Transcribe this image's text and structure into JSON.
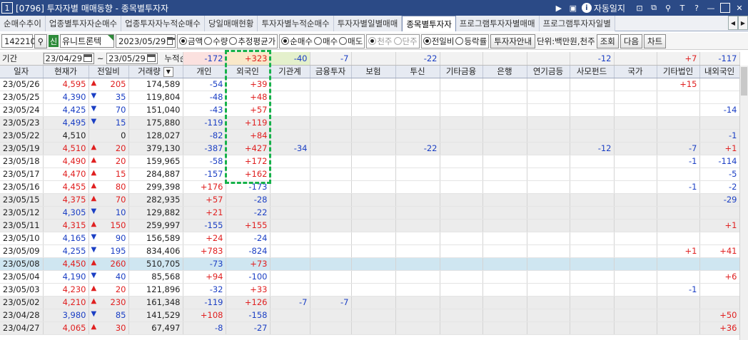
{
  "window": {
    "screen_no": "1",
    "title": "[0796] 투자자별 매매동향 - 종목별투자자",
    "autolock_label": "자동일지",
    "help_label": "?"
  },
  "tabs": [
    {
      "label": "순매수추이",
      "active": false
    },
    {
      "label": "업종별투자자순매수",
      "active": false
    },
    {
      "label": "업종투자자누적순매수",
      "active": false
    },
    {
      "label": "당일매매현황",
      "active": false
    },
    {
      "label": "투자자별누적순매수",
      "active": false
    },
    {
      "label": "투자자별일별매매",
      "active": false
    },
    {
      "label": "종목별투자자",
      "active": true
    },
    {
      "label": "프로그램투자자별매매",
      "active": false
    },
    {
      "label": "프로그램투자자일별",
      "active": false
    }
  ],
  "toolbar": {
    "stock_code": "142210",
    "badge": "신",
    "stock_name": "유니트론텍",
    "date": "2023/05/29",
    "value_type": {
      "options": [
        "금액",
        "수량",
        "추정평균가"
      ],
      "selected": "금액"
    },
    "trade_type": {
      "options": [
        "순매수",
        "매수",
        "매도"
      ],
      "selected": "순매수"
    },
    "unit_type": {
      "options": [
        "천주",
        "단주"
      ],
      "selected": "천주"
    },
    "compare_type": {
      "options": [
        "전일비",
        "등락률"
      ],
      "selected": "전일비"
    },
    "investor_info_btn": "투자자안내",
    "unit_label": "단위:백만원,천주",
    "search_btn": "조회",
    "next_btn": "다음",
    "chart_btn": "차트"
  },
  "period": {
    "label": "기간",
    "from": "23/04/29",
    "to": "23/05/29",
    "cumulative_label": "누적순매수"
  },
  "summary": {
    "individual": "-172",
    "foreign": "+323",
    "institution": "-40",
    "financial_invest": "-7",
    "insurance": "",
    "trust": "-22",
    "other_finance": "",
    "bank": "",
    "pension": "",
    "private_fund": "-12",
    "nation": "",
    "other_corp": "+7",
    "domestic_foreign": "-117"
  },
  "columns": [
    "일자",
    "현재가",
    "전일비",
    "거래량",
    "개인",
    "외국인",
    "기관계",
    "금융투자",
    "보험",
    "투신",
    "기타금융",
    "은행",
    "연기금등",
    "사모펀드",
    "국가",
    "기타법인",
    "내외국인"
  ],
  "rows": [
    {
      "date": "23/05/26",
      "price": "4,595",
      "dir": "up",
      "change": "205",
      "volume": "174,589",
      "indiv": "-54",
      "foreign": "+39",
      "inst": "",
      "fin": "",
      "ins": "",
      "trust": "",
      "etcfin": "",
      "bank": "",
      "pension": "",
      "pef": "",
      "nation": "",
      "etccorp": "+15",
      "domfor": ""
    },
    {
      "date": "23/05/25",
      "price": "4,390",
      "dir": "down",
      "change": "35",
      "volume": "119,804",
      "indiv": "-48",
      "foreign": "+48",
      "inst": "",
      "fin": "",
      "ins": "",
      "trust": "",
      "etcfin": "",
      "bank": "",
      "pension": "",
      "pef": "",
      "nation": "",
      "etccorp": "",
      "domfor": ""
    },
    {
      "date": "23/05/24",
      "price": "4,425",
      "dir": "down",
      "change": "70",
      "volume": "151,040",
      "indiv": "-43",
      "foreign": "+57",
      "inst": "",
      "fin": "",
      "ins": "",
      "trust": "",
      "etcfin": "",
      "bank": "",
      "pension": "",
      "pef": "",
      "nation": "",
      "etccorp": "",
      "domfor": "-14"
    },
    {
      "date": "23/05/23",
      "price": "4,495",
      "dir": "down",
      "change": "15",
      "volume": "175,880",
      "indiv": "-119",
      "foreign": "+119",
      "inst": "",
      "fin": "",
      "ins": "",
      "trust": "",
      "etcfin": "",
      "bank": "",
      "pension": "",
      "pef": "",
      "nation": "",
      "etccorp": "",
      "domfor": ""
    },
    {
      "date": "23/05/22",
      "price": "4,510",
      "dir": "flat",
      "change": "0",
      "volume": "128,027",
      "indiv": "-82",
      "foreign": "+84",
      "inst": "",
      "fin": "",
      "ins": "",
      "trust": "",
      "etcfin": "",
      "bank": "",
      "pension": "",
      "pef": "",
      "nation": "",
      "etccorp": "",
      "domfor": "-1"
    },
    {
      "date": "23/05/19",
      "price": "4,510",
      "dir": "up",
      "change": "20",
      "volume": "379,130",
      "indiv": "-387",
      "foreign": "+427",
      "inst": "-34",
      "fin": "",
      "ins": "",
      "trust": "-22",
      "etcfin": "",
      "bank": "",
      "pension": "",
      "pef": "-12",
      "nation": "",
      "etccorp": "-7",
      "domfor": "+1"
    },
    {
      "date": "23/05/18",
      "price": "4,490",
      "dir": "up",
      "change": "20",
      "volume": "159,965",
      "indiv": "-58",
      "foreign": "+172",
      "inst": "",
      "fin": "",
      "ins": "",
      "trust": "",
      "etcfin": "",
      "bank": "",
      "pension": "",
      "pef": "",
      "nation": "",
      "etccorp": "-1",
      "domfor": "-114"
    },
    {
      "date": "23/05/17",
      "price": "4,470",
      "dir": "up",
      "change": "15",
      "volume": "284,887",
      "indiv": "-157",
      "foreign": "+162",
      "inst": "",
      "fin": "",
      "ins": "",
      "trust": "",
      "etcfin": "",
      "bank": "",
      "pension": "",
      "pef": "",
      "nation": "",
      "etccorp": "",
      "domfor": "-5"
    },
    {
      "date": "23/05/16",
      "price": "4,455",
      "dir": "up",
      "change": "80",
      "volume": "299,398",
      "indiv": "+176",
      "foreign": "-173",
      "inst": "",
      "fin": "",
      "ins": "",
      "trust": "",
      "etcfin": "",
      "bank": "",
      "pension": "",
      "pef": "",
      "nation": "",
      "etccorp": "-1",
      "domfor": "-2"
    },
    {
      "date": "23/05/15",
      "price": "4,375",
      "dir": "up",
      "change": "70",
      "volume": "282,935",
      "indiv": "+57",
      "foreign": "-28",
      "inst": "",
      "fin": "",
      "ins": "",
      "trust": "",
      "etcfin": "",
      "bank": "",
      "pension": "",
      "pef": "",
      "nation": "",
      "etccorp": "",
      "domfor": "-29"
    },
    {
      "date": "23/05/12",
      "price": "4,305",
      "dir": "down",
      "change": "10",
      "volume": "129,882",
      "indiv": "+21",
      "foreign": "-22",
      "inst": "",
      "fin": "",
      "ins": "",
      "trust": "",
      "etcfin": "",
      "bank": "",
      "pension": "",
      "pef": "",
      "nation": "",
      "etccorp": "",
      "domfor": ""
    },
    {
      "date": "23/05/11",
      "price": "4,315",
      "dir": "up",
      "change": "150",
      "volume": "259,997",
      "indiv": "-155",
      "foreign": "+155",
      "inst": "",
      "fin": "",
      "ins": "",
      "trust": "",
      "etcfin": "",
      "bank": "",
      "pension": "",
      "pef": "",
      "nation": "",
      "etccorp": "",
      "domfor": "+1"
    },
    {
      "date": "23/05/10",
      "price": "4,165",
      "dir": "down",
      "change": "90",
      "volume": "156,589",
      "indiv": "+24",
      "foreign": "-24",
      "inst": "",
      "fin": "",
      "ins": "",
      "trust": "",
      "etcfin": "",
      "bank": "",
      "pension": "",
      "pef": "",
      "nation": "",
      "etccorp": "",
      "domfor": ""
    },
    {
      "date": "23/05/09",
      "price": "4,255",
      "dir": "down",
      "change": "195",
      "volume": "834,406",
      "indiv": "+783",
      "foreign": "-824",
      "inst": "",
      "fin": "",
      "ins": "",
      "trust": "",
      "etcfin": "",
      "bank": "",
      "pension": "",
      "pef": "",
      "nation": "",
      "etccorp": "+1",
      "domfor": "+41"
    },
    {
      "date": "23/05/08",
      "price": "4,450",
      "dir": "up",
      "change": "260",
      "volume": "510,705",
      "indiv": "-73",
      "foreign": "+73",
      "inst": "",
      "fin": "",
      "ins": "",
      "trust": "",
      "etcfin": "",
      "bank": "",
      "pension": "",
      "pef": "",
      "nation": "",
      "etccorp": "",
      "domfor": ""
    },
    {
      "date": "23/05/04",
      "price": "4,190",
      "dir": "down",
      "change": "40",
      "volume": "85,568",
      "indiv": "+94",
      "foreign": "-100",
      "inst": "",
      "fin": "",
      "ins": "",
      "trust": "",
      "etcfin": "",
      "bank": "",
      "pension": "",
      "pef": "",
      "nation": "",
      "etccorp": "",
      "domfor": "+6"
    },
    {
      "date": "23/05/03",
      "price": "4,230",
      "dir": "up",
      "change": "20",
      "volume": "121,896",
      "indiv": "-32",
      "foreign": "+33",
      "inst": "",
      "fin": "",
      "ins": "",
      "trust": "",
      "etcfin": "",
      "bank": "",
      "pension": "",
      "pef": "",
      "nation": "",
      "etccorp": "-1",
      "domfor": ""
    },
    {
      "date": "23/05/02",
      "price": "4,210",
      "dir": "up",
      "change": "230",
      "volume": "161,348",
      "indiv": "-119",
      "foreign": "+126",
      "inst": "-7",
      "fin": "-7",
      "ins": "",
      "trust": "",
      "etcfin": "",
      "bank": "",
      "pension": "",
      "pef": "",
      "nation": "",
      "etccorp": "",
      "domfor": ""
    },
    {
      "date": "23/04/28",
      "price": "3,980",
      "dir": "down",
      "change": "85",
      "volume": "141,529",
      "indiv": "+108",
      "foreign": "-158",
      "inst": "",
      "fin": "",
      "ins": "",
      "trust": "",
      "etcfin": "",
      "bank": "",
      "pension": "",
      "pef": "",
      "nation": "",
      "etccorp": "",
      "domfor": "+50"
    },
    {
      "date": "23/04/27",
      "price": "4,065",
      "dir": "up",
      "change": "30",
      "volume": "67,497",
      "indiv": "-8",
      "foreign": "-27",
      "inst": "",
      "fin": "",
      "ins": "",
      "trust": "",
      "etcfin": "",
      "bank": "",
      "pension": "",
      "pef": "",
      "nation": "",
      "etccorp": "",
      "domfor": "+36"
    }
  ],
  "selected_row_date": "23/05/08",
  "colors": {
    "up": "#e02020",
    "down": "#1b3fc4",
    "highlight": "#16b24a",
    "title_bg": "#2b4a86"
  }
}
